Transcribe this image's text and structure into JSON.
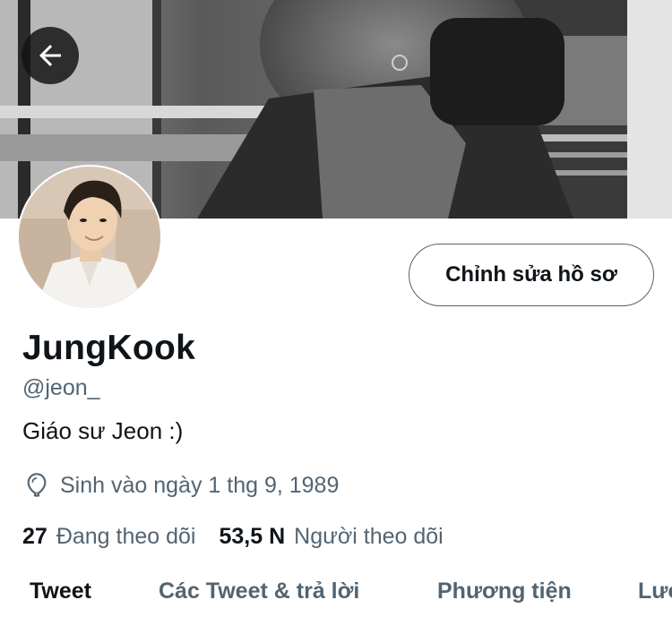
{
  "header": {
    "back_icon": "arrow-left-icon"
  },
  "profile": {
    "display_name": "JungKook",
    "handle": "@jeon_",
    "bio": "Giáo sư Jeon :)",
    "birthday_icon": "balloon-icon",
    "birthday": "Sinh vào ngày 1 thg 9, 1989",
    "edit_button_label": "Chỉnh sửa hồ sơ"
  },
  "stats": {
    "following_count": "27",
    "following_label": "Đang theo dõi",
    "followers_count": "53,5 N",
    "followers_label": "Người theo dõi"
  },
  "tabs": [
    {
      "label": "Tweet",
      "active": true
    },
    {
      "label": "Các Tweet & trả lời",
      "active": false
    },
    {
      "label": "Phương tiện",
      "active": false
    },
    {
      "label": "Lượt thích",
      "active": false
    }
  ],
  "colors": {
    "primary_text": "#0f1419",
    "secondary_text": "#536471",
    "button_border": "#536471"
  }
}
